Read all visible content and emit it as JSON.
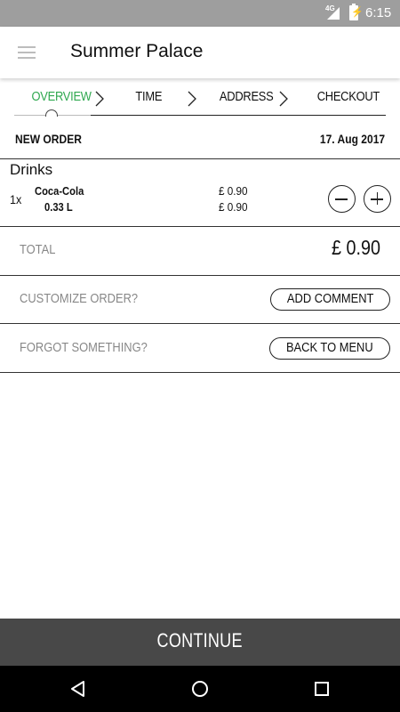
{
  "status_bar": {
    "network": "4G",
    "time": "6:15"
  },
  "app_bar": {
    "title": "Summer Palace"
  },
  "steps": [
    {
      "label": "OVERVIEW",
      "active": true
    },
    {
      "label": "TIME",
      "active": false
    },
    {
      "label": "ADDRESS",
      "active": false
    },
    {
      "label": "CHECKOUT",
      "active": false
    }
  ],
  "order": {
    "heading": "NEW ORDER",
    "date": "17. Aug 2017",
    "category": "Drinks",
    "items": [
      {
        "quantity": "1x",
        "name": "Coca-Cola",
        "size": "0.33 L",
        "unit_price": "£ 0.90",
        "line_total": "£ 0.90"
      }
    ],
    "total_label": "TOTAL",
    "total_value": "£ 0.90"
  },
  "customize": {
    "label": "CUSTOMIZE ORDER?",
    "button": "ADD COMMENT"
  },
  "forgot": {
    "label": "FORGOT SOMETHING?",
    "button": "BACK TO MENU"
  },
  "continue_label": "CONTINUE",
  "colors": {
    "active_step": "#2fa84f",
    "continue_bg": "#484848",
    "status_bar": "#9e9e9e",
    "nav_bar": "#000000"
  },
  "icons": {
    "menu": "hamburger-icon",
    "decrease": "minus-circle-icon",
    "increase": "plus-circle-icon",
    "step_separator": "chevron-right-icon",
    "nav_back": "back-triangle-icon",
    "nav_home": "home-circle-icon",
    "nav_recents": "recents-square-icon"
  }
}
